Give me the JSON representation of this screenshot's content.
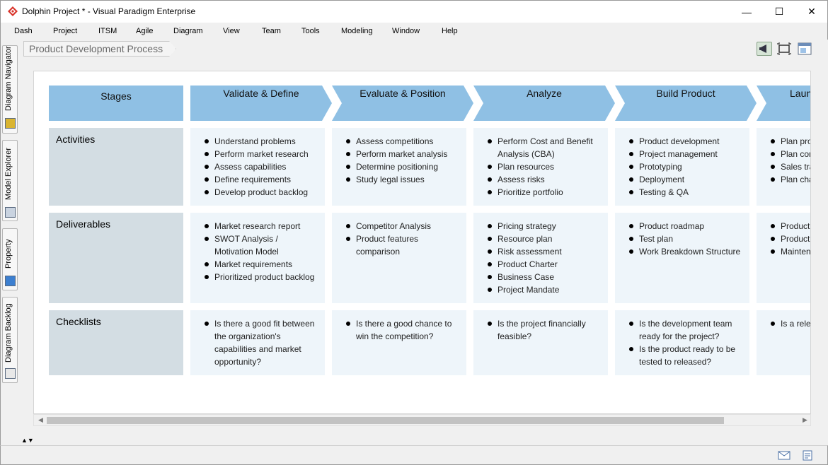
{
  "window": {
    "title": "Dolphin Project * - Visual Paradigm Enterprise",
    "app_icon": "visual-paradigm-logo",
    "controls": {
      "minimize": "—",
      "maximize": "☐",
      "close": "✕"
    }
  },
  "menu": [
    "Dash",
    "Project",
    "ITSM",
    "Agile",
    "Diagram",
    "View",
    "Team",
    "Tools",
    "Modeling",
    "Window",
    "Help"
  ],
  "side_tabs": [
    {
      "label": "Diagram Navigator",
      "icon": "diagram-navigator-icon"
    },
    {
      "label": "Model Explorer",
      "icon": "model-explorer-icon"
    },
    {
      "label": "Property",
      "icon": "property-icon"
    },
    {
      "label": "Diagram Backlog",
      "icon": "diagram-backlog-icon"
    }
  ],
  "breadcrumb": "Product Development Process",
  "toolbar_icons": [
    "megaphone-icon",
    "fit-diagram-icon",
    "diagram-overview-icon"
  ],
  "diagram": {
    "stages_header": "Stages",
    "stages": [
      "Validate & Define",
      "Evaluate & Position",
      "Analyze",
      "Build Product",
      "Laun"
    ],
    "rows": [
      {
        "label": "Activities",
        "cells": [
          [
            "Understand problems",
            "Perform market research",
            "Assess capabilities",
            "Define requirements",
            "Develop product backlog"
          ],
          [
            "Assess competitions",
            "Perform market analysis",
            "Determine positioning",
            "Study legal issues"
          ],
          [
            "Perform Cost and Benefit Analysis (CBA)",
            "Plan resources",
            "Assess risks",
            "Prioritize portfolio"
          ],
          [
            "Product development",
            "Project management",
            "Prototyping",
            "Deployment",
            "Testing & QA"
          ],
          [
            "Plan pro",
            "Plan com",
            "Sales tra",
            "Plan cha"
          ]
        ]
      },
      {
        "label": "Deliverables",
        "cells": [
          [
            "Market research report",
            "SWOT Analysis / Motivation Model",
            "Market requirements",
            "Prioritized product backlog"
          ],
          [
            "Competitor Analysis",
            "Product features comparison"
          ],
          [
            "Pricing strategy",
            "Resource plan",
            "Risk assessment",
            "Product Charter",
            "Business Case",
            "Project Mandate"
          ],
          [
            "Product roadmap",
            "Test plan",
            "Work Breakdown Structure"
          ],
          [
            "Product",
            "Product",
            "Mainten"
          ]
        ]
      },
      {
        "label": "Checklists",
        "cells": [
          [
            "Is there a good fit between the organization's capabilities and market opportunity?"
          ],
          [
            "Is there a good chance to win the competition?"
          ],
          [
            "Is the project financially feasible?"
          ],
          [
            "Is the development team ready for the project?",
            "Is the product ready to be tested to released?"
          ],
          [
            "Is a rele"
          ]
        ]
      }
    ]
  },
  "scrollbar": {
    "left_arrow": "◀",
    "right_arrow": "▶"
  },
  "collapse_control": "▲▼",
  "status_icons": [
    "mail-icon",
    "notes-icon"
  ],
  "colors": {
    "stage_header": "#8fc0e4",
    "row_label": "#d3dde3",
    "content_cell": "#eef5fa"
  }
}
